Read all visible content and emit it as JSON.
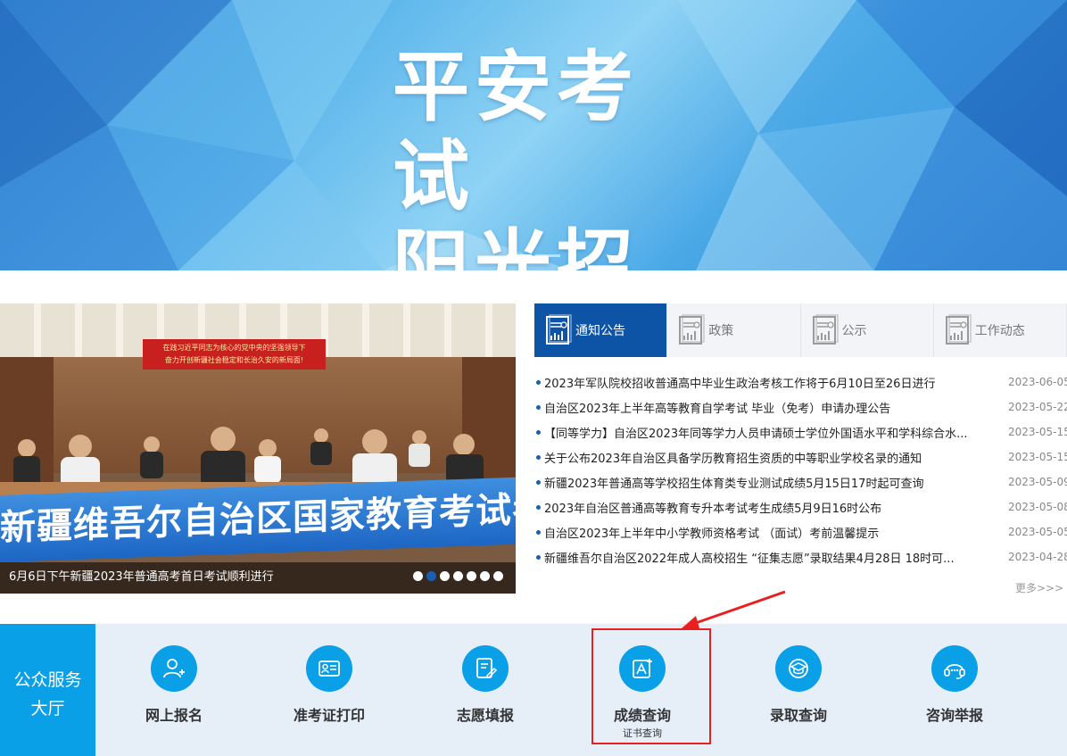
{
  "banner": {
    "line1": "平安考试",
    "line2": "阳光招生"
  },
  "carousel": {
    "caption": "6月6日下午新疆2023年普通高考首日考试顺利进行",
    "red_banner_line1": "在践习近平同志为核心的党中央的坚强领导下",
    "red_banner_line2": "奋力开创新疆社会稳定和长治久安的新局面!",
    "sign_text": "新疆维吾尔自治区国家教育考试考务指挥中心",
    "dots_total": 7,
    "dot_active": 2
  },
  "tabs": [
    {
      "label": "通知公告",
      "active": true
    },
    {
      "label": "政策",
      "active": false
    },
    {
      "label": "公示",
      "active": false
    },
    {
      "label": "工作动态",
      "active": false
    }
  ],
  "news": [
    {
      "title": "2023年军队院校招收普通高中毕业生政治考核工作将于6月10日至26日进行",
      "date": "2023-06-05"
    },
    {
      "title": "自治区2023年上半年高等教育自学考试 毕业（免考）申请办理公告",
      "date": "2023-05-22"
    },
    {
      "title": "【同等学力】自治区2023年同等学力人员申请硕士学位外国语水平和学科综合水...",
      "date": "2023-05-15"
    },
    {
      "title": "关于公布2023年自治区具备学历教育招生资质的中等职业学校名录的通知",
      "date": "2023-05-15"
    },
    {
      "title": "新疆2023年普通高等学校招生体育类专业测试成绩5月15日17时起可查询",
      "date": "2023-05-09"
    },
    {
      "title": "2023年自治区普通高等教育专升本考试考生成绩5月9日16时公布",
      "date": "2023-05-08"
    },
    {
      "title": "自治区2023年上半年中小学教师资格考试 （面试）考前温馨提示",
      "date": "2023-05-05"
    },
    {
      "title": "新疆维吾尔自治区2022年成人高校招生 “征集志愿”录取结果4月28日 18时可...",
      "date": "2023-04-28"
    }
  ],
  "more_label": "更多>>>",
  "services": {
    "label_line1": "公众服务",
    "label_line2": "大厅",
    "items": [
      {
        "label": "网上报名",
        "icon": "user-add-icon"
      },
      {
        "label": "准考证打印",
        "icon": "id-card-icon"
      },
      {
        "label": "志愿填报",
        "icon": "form-edit-icon"
      },
      {
        "label": "成绩查询",
        "sub": "证书查询",
        "icon": "score-icon"
      },
      {
        "label": "录取查询",
        "icon": "graduation-cap-icon"
      },
      {
        "label": "咨询举报",
        "icon": "headset-icon"
      }
    ]
  },
  "colors": {
    "primary": "#0d53a6",
    "service_blue": "#0aa0e8",
    "highlight_red": "#e82020"
  }
}
